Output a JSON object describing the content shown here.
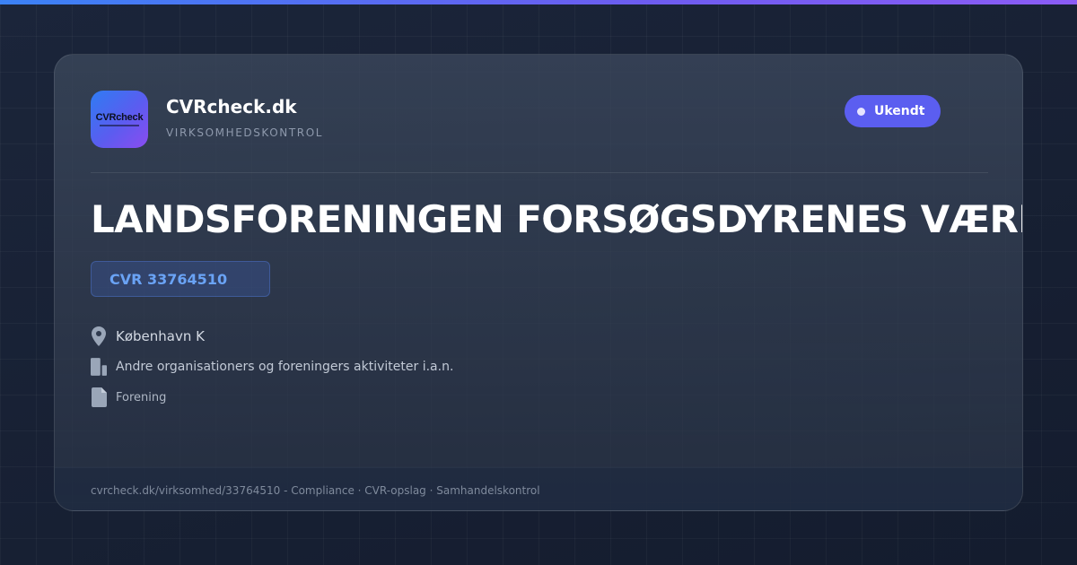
{
  "brand": {
    "logo_text": "CVRcheck",
    "name": "CVRcheck.dk",
    "tagline": "VIRKSOMHEDSKONTROL"
  },
  "status": {
    "label": "Ukendt",
    "color": "#5b5ef0"
  },
  "company": {
    "name": "LANDSFORENINGEN FORSØGSDYRENES VÆRN",
    "cvr": "CVR 33764510",
    "city": "København K",
    "industry": "Andre organisationers og foreningers aktiviteter i.a.n.",
    "type": "Forening"
  },
  "icons": {
    "city": "map-pin-icon",
    "industry": "building-icon",
    "type": "document-icon"
  },
  "footer": {
    "text": "cvrcheck.dk/virksomhed/33764510 - Compliance · CVR-opslag · Samhandelskontrol"
  },
  "colors": {
    "accent_blue": "#3b82f6",
    "accent_purple": "#8b5cf6",
    "cvr_text": "#6aa3f5"
  }
}
